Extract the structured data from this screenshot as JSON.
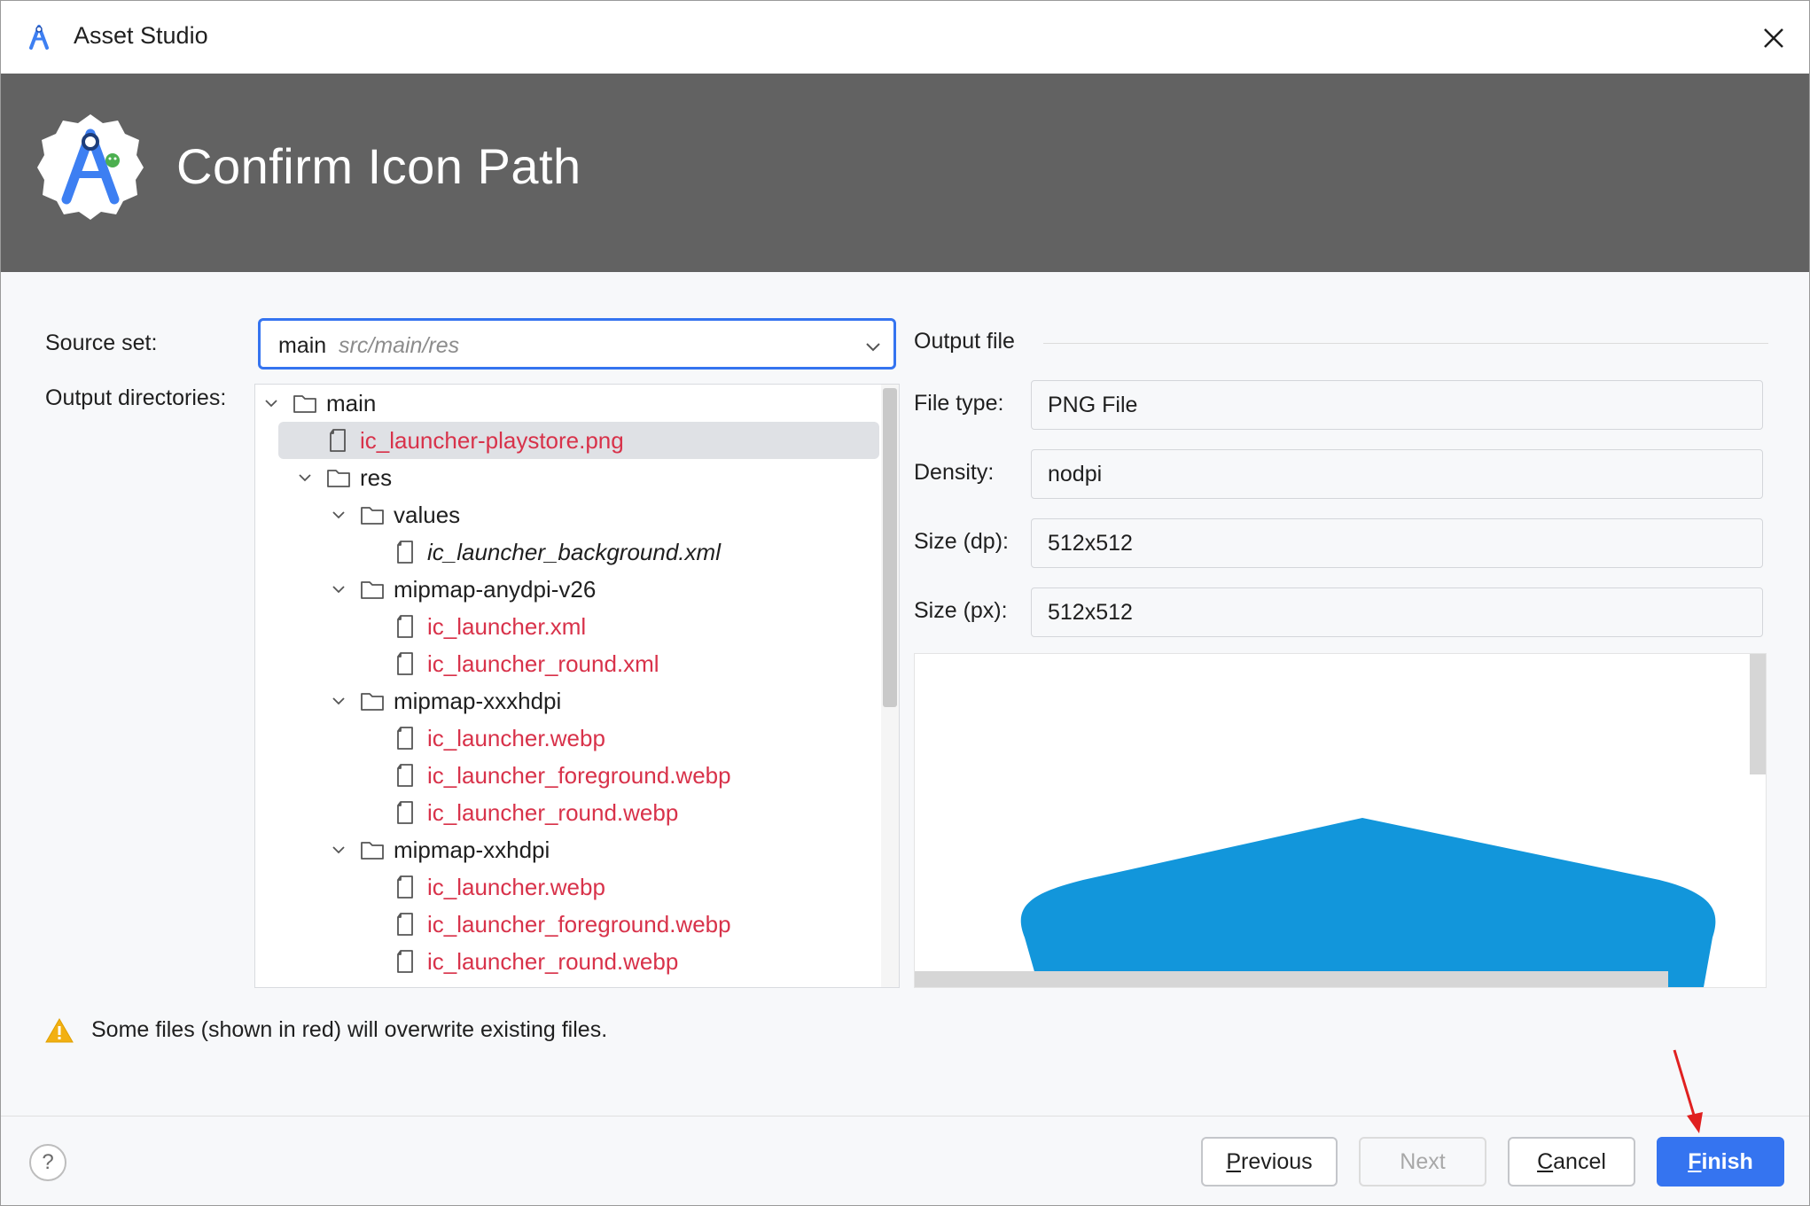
{
  "window": {
    "title": "Asset Studio"
  },
  "banner": {
    "title": "Confirm Icon Path"
  },
  "form": {
    "source_set_label": "Source set:",
    "source_set_value": "main",
    "source_set_path": "src/main/res",
    "output_dirs_label": "Output directories:"
  },
  "tree": [
    {
      "label": "main",
      "type": "folder",
      "depth": 0,
      "expanded": true,
      "overwrite": false
    },
    {
      "label": "ic_launcher-playstore.png",
      "type": "file",
      "depth": 1,
      "overwrite": true,
      "selected": true
    },
    {
      "label": "res",
      "type": "folder",
      "depth": 1,
      "expanded": true,
      "overwrite": false
    },
    {
      "label": "values",
      "type": "folder",
      "depth": 2,
      "expanded": true,
      "overwrite": false
    },
    {
      "label": "ic_launcher_background.xml",
      "type": "file",
      "depth": 3,
      "overwrite": false,
      "italic": true
    },
    {
      "label": "mipmap-anydpi-v26",
      "type": "folder",
      "depth": 2,
      "expanded": true,
      "overwrite": false
    },
    {
      "label": "ic_launcher.xml",
      "type": "file",
      "depth": 3,
      "overwrite": true
    },
    {
      "label": "ic_launcher_round.xml",
      "type": "file",
      "depth": 3,
      "overwrite": true
    },
    {
      "label": "mipmap-xxxhdpi",
      "type": "folder",
      "depth": 2,
      "expanded": true,
      "overwrite": false
    },
    {
      "label": "ic_launcher.webp",
      "type": "file",
      "depth": 3,
      "overwrite": true
    },
    {
      "label": "ic_launcher_foreground.webp",
      "type": "file",
      "depth": 3,
      "overwrite": true
    },
    {
      "label": "ic_launcher_round.webp",
      "type": "file",
      "depth": 3,
      "overwrite": true
    },
    {
      "label": "mipmap-xxhdpi",
      "type": "folder",
      "depth": 2,
      "expanded": true,
      "overwrite": false
    },
    {
      "label": "ic_launcher.webp",
      "type": "file",
      "depth": 3,
      "overwrite": true
    },
    {
      "label": "ic_launcher_foreground.webp",
      "type": "file",
      "depth": 3,
      "overwrite": true
    },
    {
      "label": "ic_launcher_round.webp",
      "type": "file",
      "depth": 3,
      "overwrite": true
    }
  ],
  "output": {
    "heading": "Output file",
    "file_type_label": "File type:",
    "file_type": "PNG File",
    "density_label": "Density:",
    "density": "nodpi",
    "size_dp_label": "Size (dp):",
    "size_dp": "512x512",
    "size_px_label": "Size (px):",
    "size_px": "512x512"
  },
  "warning": {
    "text": "Some files (shown in red) will overwrite existing files.",
    "icon": "warning-icon"
  },
  "footer": {
    "help": "?",
    "previous_mnemonic": "P",
    "previous_rest": "revious",
    "next": "Next",
    "cancel_mnemonic": "C",
    "cancel_rest": "ancel",
    "finish_mnemonic": "F",
    "finish_rest": "inish"
  },
  "colors": {
    "accent": "#3574f0",
    "overwrite_red": "#d8324a",
    "banner_bg": "#626262",
    "preview_icon": "#1296db"
  }
}
